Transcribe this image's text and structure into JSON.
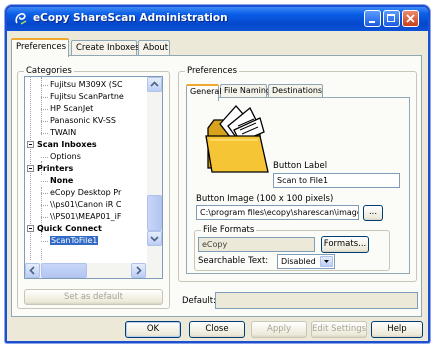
{
  "window": {
    "title": "eCopy ShareScan Administration"
  },
  "tabs": [
    {
      "label": "Preferences",
      "active": true
    },
    {
      "label": "Create Inboxes",
      "active": false
    },
    {
      "label": "About",
      "active": false
    }
  ],
  "categories": {
    "legend": "Categories",
    "tree": [
      {
        "label": "Fujitsu M309X (SC",
        "level": 2
      },
      {
        "label": "Fujitsu ScanPartne",
        "level": 2
      },
      {
        "label": "HP ScanJet",
        "level": 2
      },
      {
        "label": "Panasonic KV-SS",
        "level": 2
      },
      {
        "label": "TWAIN",
        "level": 2
      },
      {
        "label": "Scan Inboxes",
        "level": 1,
        "bold": true
      },
      {
        "label": "Options",
        "level": 2
      },
      {
        "label": "Printers",
        "level": 1,
        "bold": true
      },
      {
        "label": "None",
        "level": 2,
        "bold": true
      },
      {
        "label": "eCopy Desktop Pr",
        "level": 2
      },
      {
        "label": "\\\\ps01\\Canon iR C",
        "level": 2
      },
      {
        "label": "\\\\PS01\\MEAP01_iF",
        "level": 2
      },
      {
        "label": "Quick Connect",
        "level": 1,
        "bold": true
      },
      {
        "label": "ScanToFile1",
        "level": 2,
        "selected": true
      }
    ],
    "set_default_label": "Set as default"
  },
  "preferences": {
    "legend": "Preferences",
    "inner_tabs": [
      {
        "label": "General",
        "active": true
      },
      {
        "label": "File Naming",
        "active": false
      },
      {
        "label": "Destinations",
        "active": false
      }
    ],
    "button_label_caption": "Button Label",
    "button_label_value": "Scan to File1",
    "button_image_caption": "Button Image (100 x 100 pixels)",
    "button_image_path": "C:\\program files\\ecopy\\sharescan\\images",
    "browse_label": "...",
    "file_formats_legend": "File Formats",
    "file_format_value": "eCopy",
    "formats_button": "Formats...",
    "searchable_text_caption": "Searchable Text:",
    "searchable_text_value": "Disabled"
  },
  "default": {
    "label": "Default:",
    "value": ""
  },
  "footer": {
    "ok": "OK",
    "close": "Close",
    "apply": "Apply",
    "edit_settings": "Edit Settings",
    "help": "Help"
  }
}
